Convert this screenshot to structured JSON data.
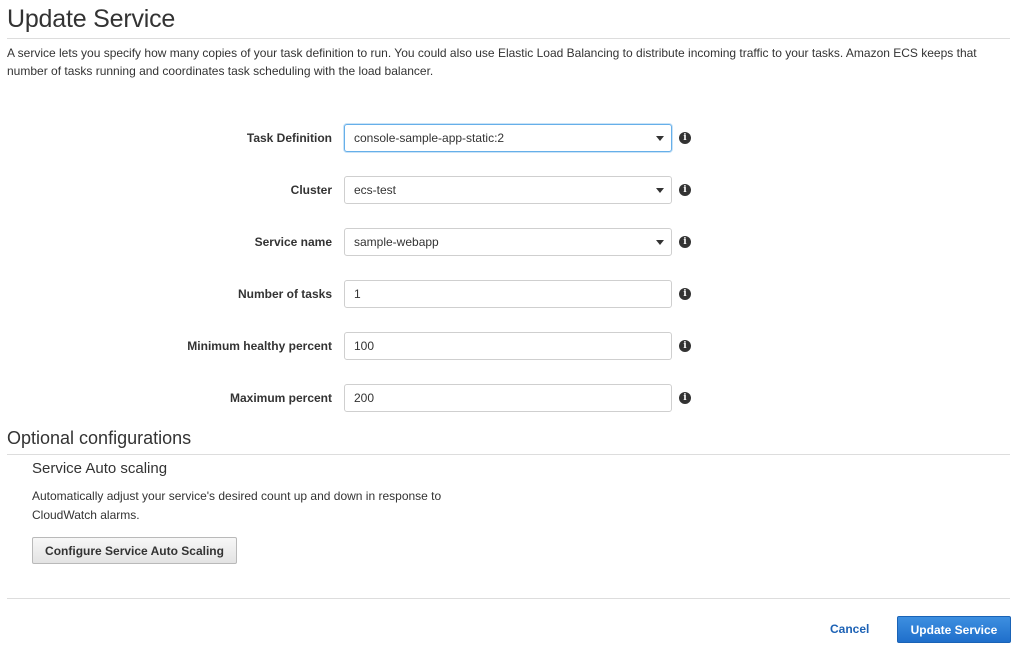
{
  "page": {
    "title": "Update Service",
    "description": "A service lets you specify how many copies of your task definition to run. You could also use Elastic Load Balancing to distribute incoming traffic to your tasks. Amazon ECS keeps that number of tasks running and coordinates task scheduling with the load balancer."
  },
  "form": {
    "task_definition": {
      "label": "Task Definition",
      "value": "console-sample-app-static:2",
      "icon": "info-icon"
    },
    "cluster": {
      "label": "Cluster",
      "value": "ecs-test",
      "icon": "info-icon"
    },
    "service_name": {
      "label": "Service name",
      "value": "sample-webapp",
      "icon": "info-icon"
    },
    "number_of_tasks": {
      "label": "Number of tasks",
      "value": "1",
      "icon": "info-icon"
    },
    "minimum_healthy_percent": {
      "label": "Minimum healthy percent",
      "value": "100",
      "icon": "info-icon"
    },
    "maximum_percent": {
      "label": "Maximum percent",
      "value": "200",
      "icon": "info-icon"
    }
  },
  "optional": {
    "title": "Optional configurations",
    "auto_scaling": {
      "title": "Service Auto scaling",
      "description": "Automatically adjust your service's desired count up and down in response to CloudWatch alarms.",
      "button_label": "Configure Service Auto Scaling"
    }
  },
  "footer": {
    "cancel_label": "Cancel",
    "submit_label": "Update Service"
  },
  "colors": {
    "primary_button": "#2a7bd6",
    "link": "#1d62b5",
    "focus_border": "#66afe9"
  }
}
